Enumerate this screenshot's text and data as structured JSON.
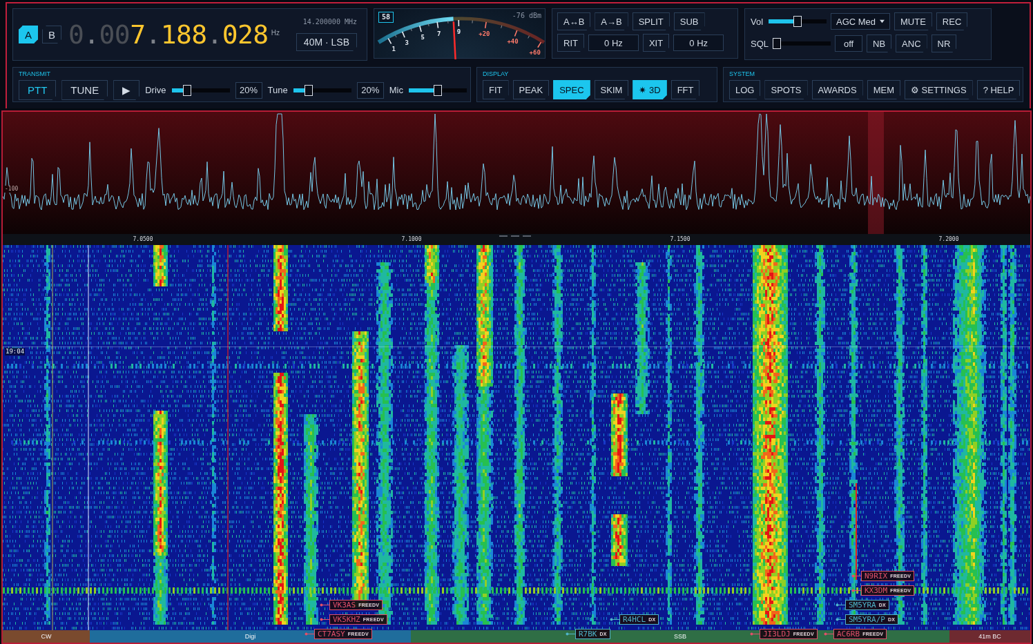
{
  "vfo": {
    "buttons": [
      {
        "label": "A",
        "selected": true
      },
      {
        "label": "B",
        "selected": false
      }
    ],
    "frequency": [
      {
        "kind": "dim",
        "text": "0"
      },
      {
        "kind": "dot",
        "text": "."
      },
      {
        "kind": "dim",
        "text": "00"
      },
      {
        "kind": "lit",
        "text": "7"
      },
      {
        "kind": "dot",
        "text": "."
      },
      {
        "kind": "lit",
        "text": "188"
      },
      {
        "kind": "dot",
        "text": "."
      },
      {
        "kind": "lit",
        "text": "028"
      }
    ],
    "unit": "Hz",
    "reference": "14.200000 MHz",
    "band_mode": "40M · LSB"
  },
  "s_meter": {
    "badge": "58",
    "reading": "-76 dBm",
    "level": 0.455,
    "scale": [
      {
        "label": "1",
        "kind": "s"
      },
      {
        "label": "3",
        "kind": "s"
      },
      {
        "label": "5",
        "kind": "s"
      },
      {
        "label": "7",
        "kind": "s"
      },
      {
        "label": "9",
        "kind": "s"
      },
      {
        "label": "+20",
        "kind": "over"
      },
      {
        "label": "+40",
        "kind": "over"
      },
      {
        "label": "+60",
        "kind": "over"
      }
    ]
  },
  "vfo_controls": {
    "buttons": [
      "A↔B",
      "A→B",
      "SPLIT",
      "SUB"
    ],
    "offsets": [
      {
        "label": "RIT",
        "value": "0 Hz"
      },
      {
        "label": "XIT",
        "value": "0 Hz"
      }
    ]
  },
  "audio": {
    "sliders": [
      {
        "label": "Vol",
        "level": 0.5
      },
      {
        "label": "SQL",
        "level": 0
      }
    ],
    "agc": "AGC Med",
    "buttons": [
      "MUTE",
      "REC"
    ],
    "squelch_value": "off",
    "filters": [
      "NB",
      "ANC",
      "NR"
    ]
  },
  "transmit": {
    "title": "TRANSMIT",
    "buttons": [
      {
        "label": "PTT",
        "accent": true
      },
      {
        "label": "TUNE",
        "accent": false
      },
      {
        "label": "▶",
        "accent": false
      }
    ],
    "controls": [
      {
        "label": "Drive",
        "level": 0.23,
        "value": "20%"
      },
      {
        "label": "Tune",
        "level": 0.23,
        "value": "20%"
      },
      {
        "label": "Mic",
        "level": 0.5
      }
    ]
  },
  "display": {
    "title": "DISPLAY",
    "buttons": [
      {
        "label": "FIT",
        "selected": false
      },
      {
        "label": "PEAK",
        "selected": false
      },
      {
        "label": "SPEC",
        "selected": true
      },
      {
        "label": "SKIM",
        "selected": false
      },
      {
        "label": "✷ 3D",
        "selected": true
      },
      {
        "label": "FFT",
        "selected": false
      }
    ]
  },
  "system": {
    "title": "SYSTEM",
    "buttons": [
      "LOG",
      "SPOTS",
      "AWARDS",
      "MEM",
      "⚙ SETTINGS",
      "? HELP"
    ]
  },
  "spectrum": {
    "level_label": "-100",
    "frequency_labels": [
      "7.0500",
      "7.1000",
      "7.1500",
      "7.2000"
    ]
  },
  "waterfall": {
    "time_label": "19:04",
    "spots": [
      {
        "call": "N9RIX",
        "mode": "FREEDV",
        "color": "#e0506a"
      },
      {
        "call": "KX3DM",
        "mode": "FREEDV",
        "color": "#e0506a"
      },
      {
        "call": "VK3AS",
        "mode": "FREEDV",
        "color": "#e0506a"
      },
      {
        "call": "SM5YRA",
        "mode": "DX",
        "color": "#4fb4c8"
      },
      {
        "call": "VK5KHZ",
        "mode": "FREEDV",
        "color": "#e0506a"
      },
      {
        "call": "R4HCL",
        "mode": "DX",
        "color": "#4fb4c8"
      },
      {
        "call": "SM5YRA/P",
        "mode": "DX",
        "color": "#4fb4c8"
      },
      {
        "call": "CT7ASY",
        "mode": "FREEDV",
        "color": "#e0506a"
      },
      {
        "call": "R7BK",
        "mode": "DX",
        "color": "#4fb4c8"
      },
      {
        "call": "JI3LDJ",
        "mode": "FREEDV",
        "color": "#e0506a"
      },
      {
        "call": "AC6RB",
        "mode": "FREEDV",
        "color": "#e0506a"
      }
    ]
  },
  "band_plan": [
    {
      "label": "CW",
      "color": "#7a4a2e"
    },
    {
      "label": "Digi",
      "color": "#1f6d9c"
    },
    {
      "label": "SSB",
      "color": "#2f6e45"
    },
    {
      "label": "41m BC",
      "color": "#6e2a30"
    }
  ]
}
